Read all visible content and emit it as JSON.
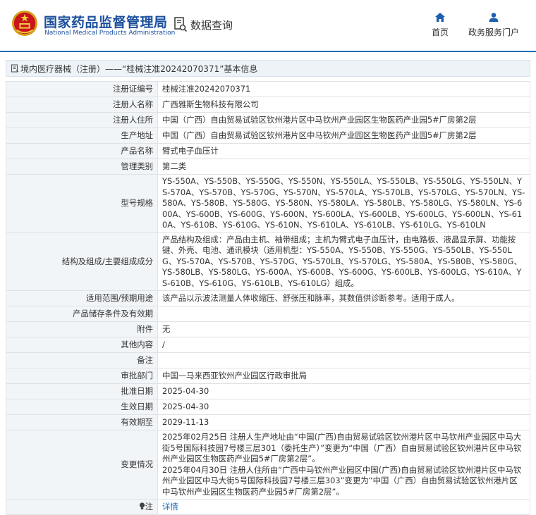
{
  "header": {
    "logo_cn": "国家药品监督管理局",
    "logo_en": "National Medical Products Administration",
    "data_query_label": "数据查询",
    "nav": [
      {
        "label": "首页",
        "icon": "home-icon"
      },
      {
        "label": "政务服务门户",
        "icon": "user-icon"
      }
    ],
    "accent_color": "#1f6fc0"
  },
  "page": {
    "title": "境内医疗器械（注册）——“桂械注准20242070371”基本信息"
  },
  "record": [
    {
      "label": "注册证编号",
      "value": "桂械注准20242070371"
    },
    {
      "label": "注册人名称",
      "value": "广西雅斯生物科技有限公司"
    },
    {
      "label": "注册人住所",
      "value": "中国（广西）自由贸易试验区钦州港片区中马钦州产业园区生物医药产业园5#厂房第2层"
    },
    {
      "label": "生产地址",
      "value": "中国（广西）自由贸易试验区钦州港片区中马钦州产业园区生物医药产业园5#厂房第2层"
    },
    {
      "label": "产品名称",
      "value": "臂式电子血压计"
    },
    {
      "label": "管理类别",
      "value": "第二类"
    },
    {
      "label": "型号规格",
      "value": "YS-550A、YS-550B、YS-550G、YS-550N、YS-550LA、YS-550LB、YS-550LG、YS-550LN、YS-570A、YS-570B、YS-570G、YS-570N、YS-570LA、YS-570LB、YS-570LG、YS-570LN、YS-580A、YS-580B、YS-580G、YS-580N、YS-580LA、YS-580LB、YS-580LG、YS-580LN、YS-600A、YS-600B、YS-600G、YS-600N、YS-600LA、YS-600LB、YS-600LG、YS-600LN、YS-610A、YS-610B、YS-610G、YS-610N、YS-610LA、YS-610LB、YS-610LG、YS-610LN"
    },
    {
      "label": "结构及组成/主要组成成分",
      "value": "产品结构及组成：产品由主机、袖带组成；主机为臂式电子血压计，由电路板、液晶显示屏、功能按键、外壳、电池、通讯模块（适用机型：YS-550A、YS-550B、YS-550G、YS-550LB、YS-550LG、YS-570A、YS-570B、YS-570G、YS-570LB、YS-570LG、YS-580A、YS-580B、YS-580G、YS-580LB、YS-580LG、YS-600A、YS-600B、YS-600G、YS-600LB、YS-600LG、YS-610A、YS-610B、YS-610G、YS-610LB、YS-610LG）组成。"
    },
    {
      "label": "适用范围/预期用途",
      "value": "该产品以示波法测量人体收缩压、舒张压和脉率，其数值供诊断参考。适用于成人。"
    },
    {
      "label": "产品储存条件及有效期",
      "value": ""
    },
    {
      "label": "附件",
      "value": "无"
    },
    {
      "label": "其他内容",
      "value": "/"
    },
    {
      "label": "备注",
      "value": ""
    },
    {
      "label": "审批部门",
      "value": "中国—马来西亚钦州产业园区行政审批局"
    },
    {
      "label": "批准日期",
      "value": "2025-04-30"
    },
    {
      "label": "生效日期",
      "value": "2025-04-30"
    },
    {
      "label": "有效期至",
      "value": "2029-11-13"
    },
    {
      "label": "变更情况",
      "value": "2025年02月25日 注册人生产地址由“中国(广西)自由贸易试验区钦州港片区中马钦州产业园区中马大街5号国际科技园7号楼三层301（委托生产）”变更为“中国（广西）自由贸易试验区钦州港片区中马钦州产业园区生物医药产业园5#厂房第2层”。\n2025年04月30日 注册人住所由“广西中马钦州产业园区中国(广西)自由贸易试验区钦州港片区中马钦州产业园区中马大街5号国际科技园7号楼三层303”变更为“中国（广西）自由贸易试验区钦州港片区中马钦州产业园区生物医药产业园5#厂房第2层”。"
    }
  ],
  "note": {
    "label": "注",
    "icon": "lightbulb-icon",
    "link_text": "详情"
  }
}
